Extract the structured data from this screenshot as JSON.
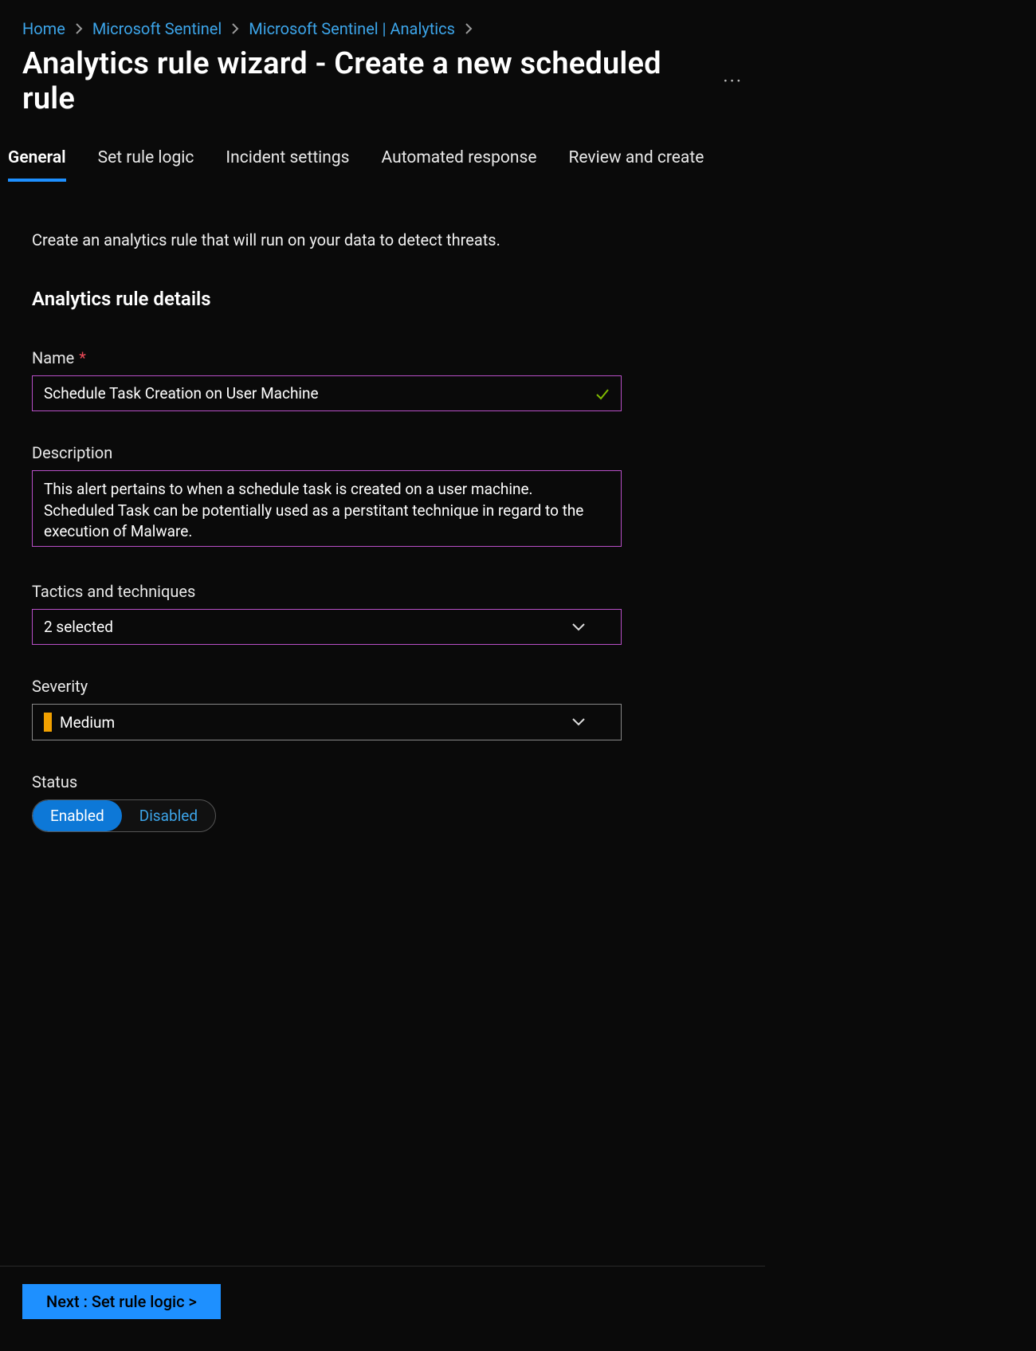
{
  "breadcrumb": {
    "items": [
      {
        "label": "Home"
      },
      {
        "label": "Microsoft Sentinel"
      },
      {
        "label": "Microsoft Sentinel | Analytics"
      }
    ]
  },
  "title": "Analytics rule wizard - Create a new scheduled rule",
  "more_icon": "···",
  "tabs": [
    {
      "label": "General",
      "active": true
    },
    {
      "label": "Set rule logic",
      "active": false
    },
    {
      "label": "Incident settings",
      "active": false
    },
    {
      "label": "Automated response",
      "active": false
    },
    {
      "label": "Review and create",
      "active": false
    }
  ],
  "intro_text": "Create an analytics rule that will run on your data to detect threats.",
  "section_title": "Analytics rule details",
  "fields": {
    "name": {
      "label": "Name",
      "required": true,
      "value": "Schedule Task Creation on User Machine",
      "validated": true
    },
    "description": {
      "label": "Description",
      "value": "This alert pertains to when a schedule task is created on a user machine. Scheduled Task can be potentially used as a perstitant technique in regard to the execution of Malware."
    },
    "tactics": {
      "label": "Tactics and techniques",
      "value": "2 selected"
    },
    "severity": {
      "label": "Severity",
      "value": "Medium",
      "color": "#f2a100"
    },
    "status": {
      "label": "Status",
      "enabled_label": "Enabled",
      "disabled_label": "Disabled",
      "value": "Enabled"
    }
  },
  "footer": {
    "next_button": "Next : Set rule logic >"
  }
}
